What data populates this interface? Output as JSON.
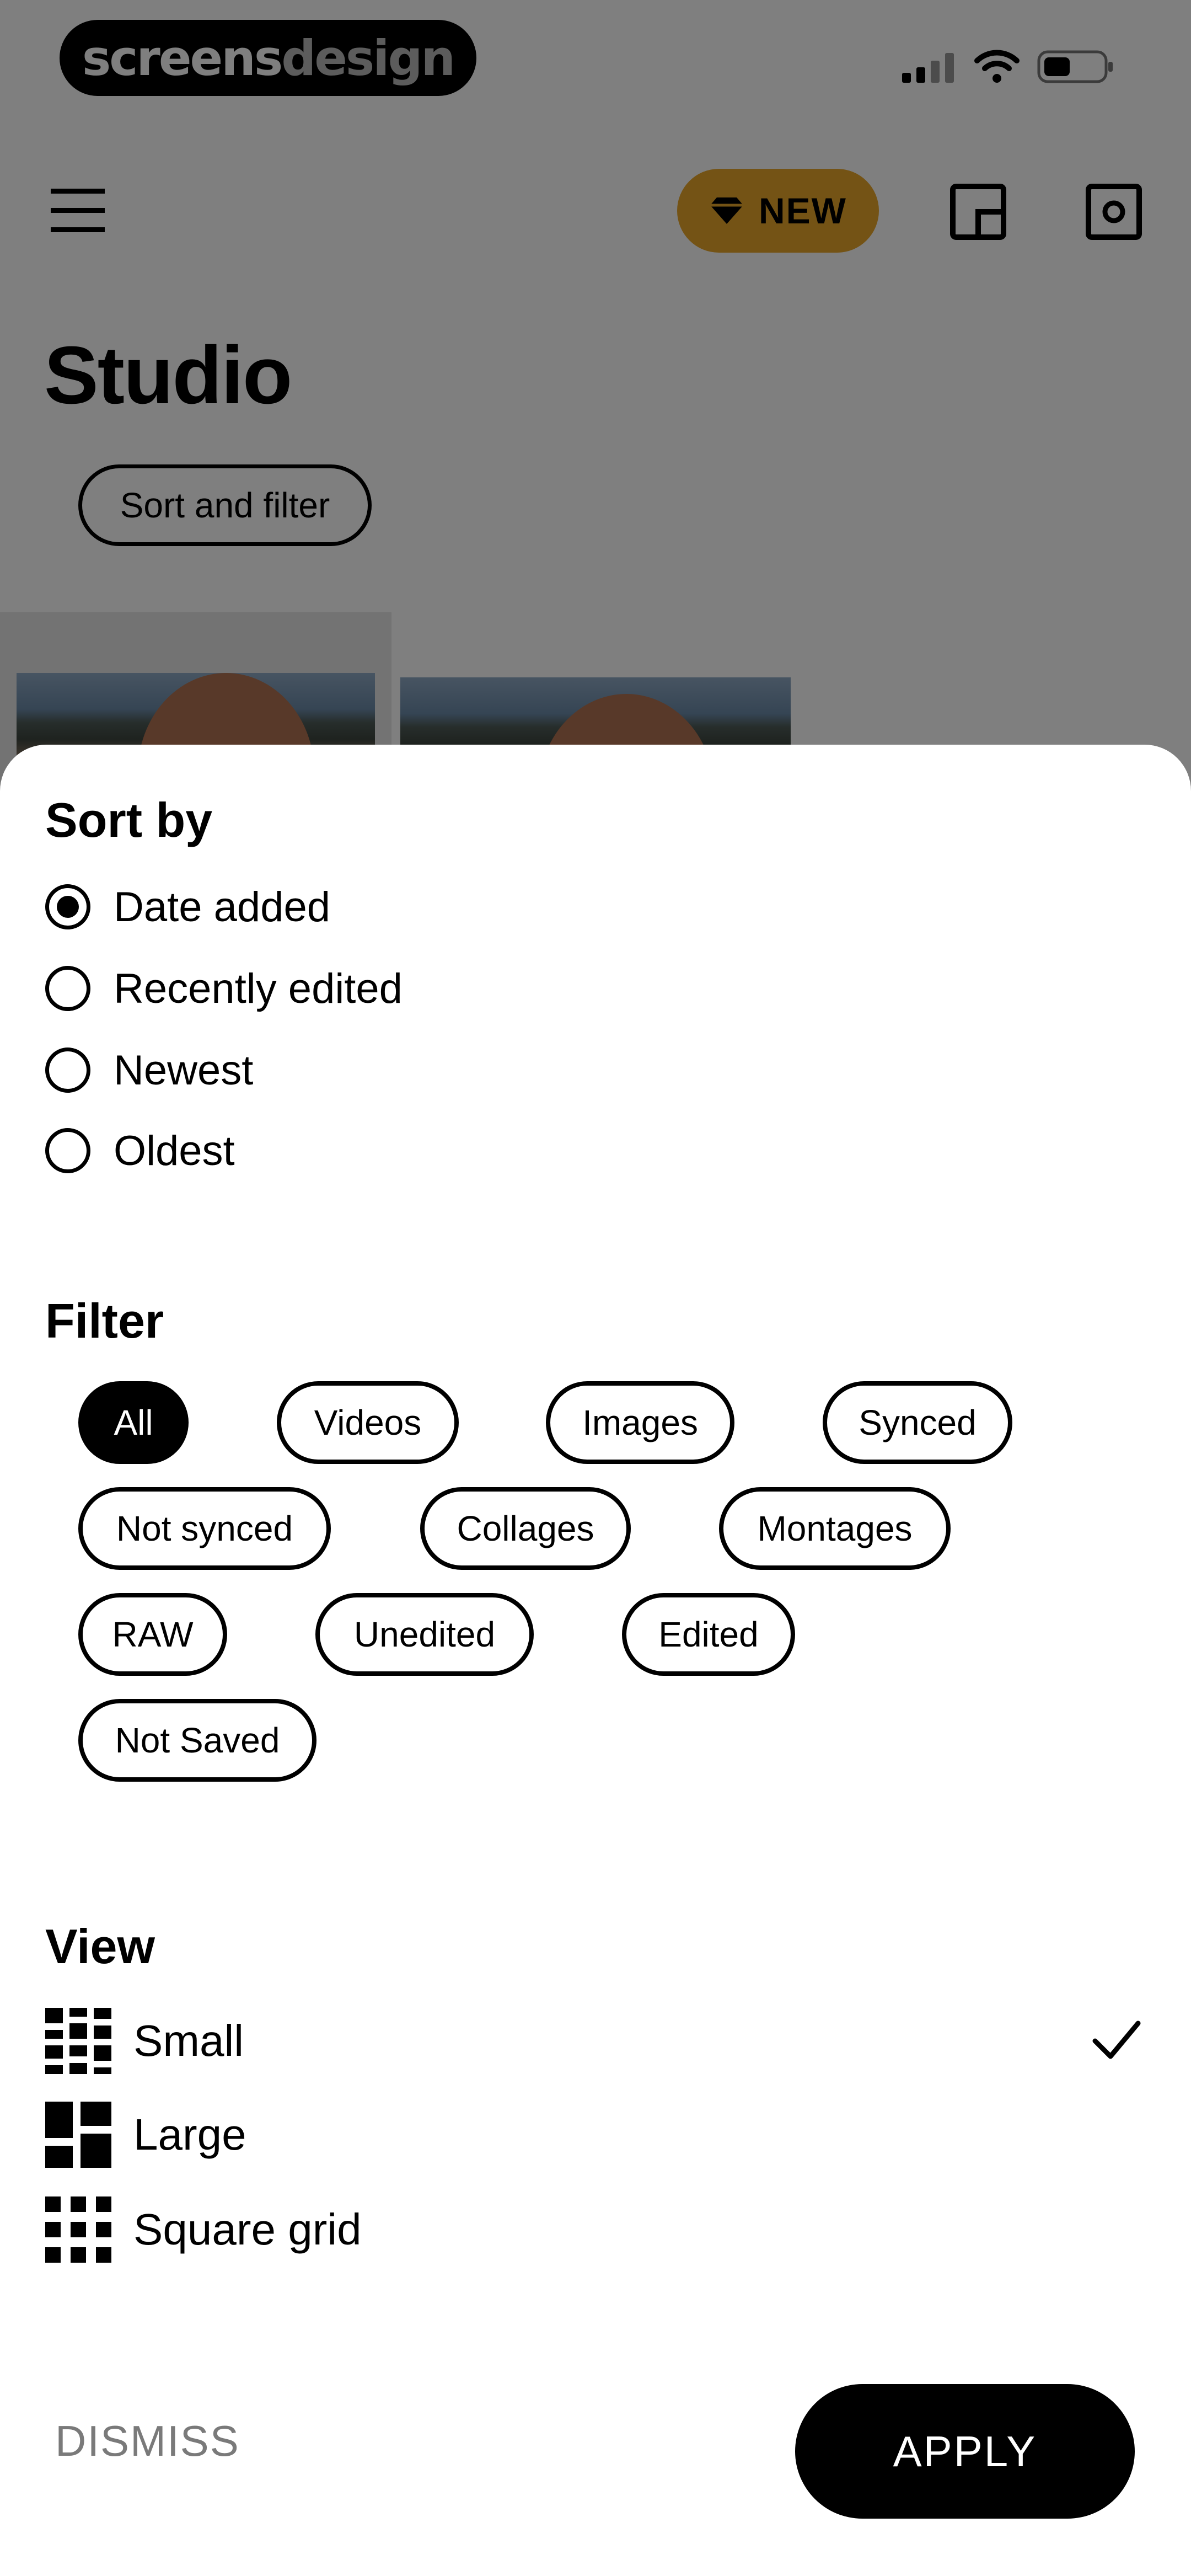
{
  "watermark": {
    "part1": "screens",
    "part2": "design"
  },
  "status_bar": {
    "signal_icon": "cellular-signal-icon",
    "wifi_icon": "wifi-icon",
    "battery_icon": "battery-icon"
  },
  "header": {
    "menu_icon": "hamburger-menu-icon",
    "new_badge": {
      "icon": "diamond-icon",
      "label": "NEW"
    },
    "layout_icon": "layout-icon",
    "camera_icon": "square-dot-icon",
    "badge_color": "#e8a72a"
  },
  "page": {
    "title": "Studio",
    "sort_filter_label": "Sort and filter"
  },
  "sheet": {
    "sort_by": {
      "title": "Sort by",
      "options": [
        {
          "label": "Date added",
          "checked": true
        },
        {
          "label": "Recently edited",
          "checked": false
        },
        {
          "label": "Newest",
          "checked": false
        },
        {
          "label": "Oldest",
          "checked": false
        }
      ]
    },
    "filter": {
      "title": "Filter",
      "chips": [
        {
          "label": "All",
          "selected": true
        },
        {
          "label": "Videos",
          "selected": false
        },
        {
          "label": "Images",
          "selected": false
        },
        {
          "label": "Synced",
          "selected": false
        },
        {
          "label": "Not synced",
          "selected": false
        },
        {
          "label": "Collages",
          "selected": false
        },
        {
          "label": "Montages",
          "selected": false
        },
        {
          "label": "RAW",
          "selected": false
        },
        {
          "label": "Unedited",
          "selected": false
        },
        {
          "label": "Edited",
          "selected": false
        },
        {
          "label": "Not Saved",
          "selected": false
        }
      ]
    },
    "view": {
      "title": "View",
      "options": [
        {
          "label": "Small",
          "icon": "small-grid-icon",
          "selected": true
        },
        {
          "label": "Large",
          "icon": "large-grid-icon",
          "selected": false
        },
        {
          "label": "Square grid",
          "icon": "square-grid-icon",
          "selected": false
        }
      ],
      "check_icon": "checkmark-icon"
    },
    "actions": {
      "dismiss": "DISMISS",
      "apply": "APPLY"
    }
  }
}
